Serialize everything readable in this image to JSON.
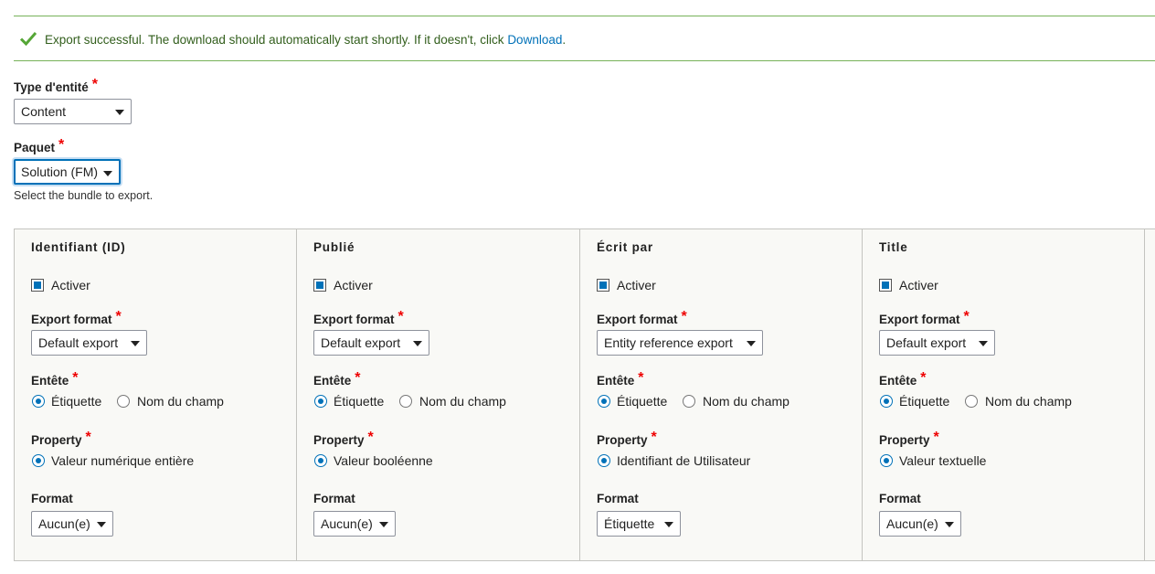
{
  "message": {
    "text": "Export successful. The download should automatically start shortly. If it doesn't, click ",
    "link": "Download",
    "suffix": "."
  },
  "entity_type": {
    "label": "Type d'entité",
    "required": "*",
    "value": "Content"
  },
  "bundle": {
    "label": "Paquet",
    "required": "*",
    "value": "Solution (FM)",
    "description": "Select the bundle to export."
  },
  "columns": [
    {
      "title": "Identifiant (ID)",
      "enable": "Activer",
      "export_format_label": "Export format",
      "export_format": "Default export",
      "header_label": "Entête",
      "header_opt1": "Étiquette",
      "header_opt2": "Nom du champ",
      "property_label": "Property",
      "property": "Valeur numérique entière",
      "format_label": "Format",
      "format": "Aucun(e)"
    },
    {
      "title": "Publié",
      "enable": "Activer",
      "export_format_label": "Export format",
      "export_format": "Default export",
      "header_label": "Entête",
      "header_opt1": "Étiquette",
      "header_opt2": "Nom du champ",
      "property_label": "Property",
      "property": "Valeur booléenne",
      "format_label": "Format",
      "format": "Aucun(e)"
    },
    {
      "title": "Écrit par",
      "enable": "Activer",
      "export_format_label": "Export format",
      "export_format": "Entity reference export",
      "header_label": "Entête",
      "header_opt1": "Étiquette",
      "header_opt2": "Nom du champ",
      "property_label": "Property",
      "property": "Identifiant de Utilisateur",
      "format_label": "Format",
      "format": "Étiquette"
    },
    {
      "title": "Title",
      "enable": "Activer",
      "export_format_label": "Export format",
      "export_format": "Default export",
      "header_label": "Entête",
      "header_opt1": "Étiquette",
      "header_opt2": "Nom du champ",
      "property_label": "Property",
      "property": "Valeur textuelle",
      "format_label": "Format",
      "format": "Aucun(e)"
    }
  ],
  "required_marker": "*",
  "colors": {
    "accent": "#0071b8",
    "success": "#77b259",
    "required": "#e00000"
  }
}
